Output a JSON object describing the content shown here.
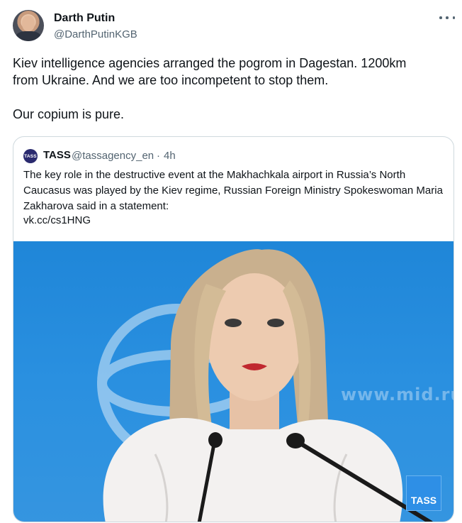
{
  "author": {
    "name": "Darth Putin",
    "handle": "@DarthPutinKGB",
    "avatar_icon": "avatar"
  },
  "more_icon": "more-options-icon",
  "tweet": {
    "text": "Kiev intelligence agencies arranged the pogrom in Dagestan. 1200km\nfrom Ukraine. And we are too incompetent to stop them.\n\nOur copium is pure."
  },
  "quoted": {
    "logo_text": "TASS",
    "name": "TASS",
    "handle": "@tassagency_en",
    "separator": "·",
    "time": "4h",
    "text": "The key role in the destructive event at the Makhachkala airport in Russia’s North Caucasus was played by the Kiev regime, Russian Foreign Ministry Spokeswoman Maria Zakharova said in a statement:",
    "link": "vk.cc/cs1HNG",
    "photo": {
      "watermark": "www.mid.ru",
      "badge": "TASS"
    }
  },
  "colors": {
    "text_primary": "#0f1419",
    "text_secondary": "#536471",
    "border": "#cfd9de",
    "photo_background": "#2a8fe0"
  }
}
